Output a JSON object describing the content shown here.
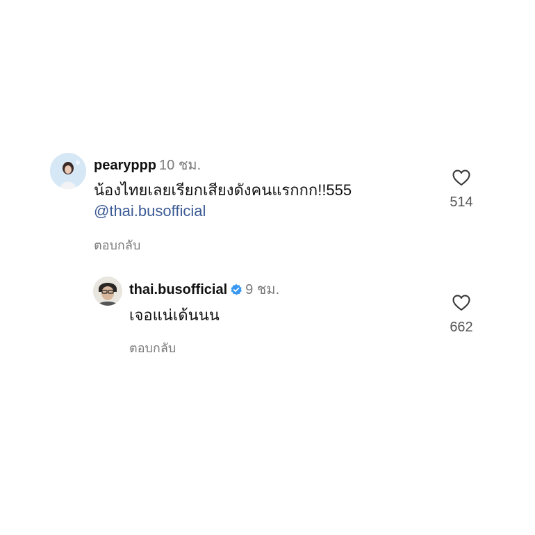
{
  "comments": [
    {
      "username": "pearyppp",
      "time": "10 ชม.",
      "text": "น้องไทยเลยเรียกเสียงดังคนแรกกก!!555",
      "mention": "@thai.busofficial",
      "reply_label": "ตอบกลับ",
      "likes": "514",
      "avatar_icon": "profile-photo"
    },
    {
      "username": "thai.busofficial",
      "verified": true,
      "time": "9 ชม.",
      "text": "เจอแน่เด้นนน",
      "reply_label": "ตอบกลับ",
      "likes": "662",
      "avatar_icon": "profile-photo"
    }
  ],
  "colors": {
    "mention": "#3b5a94",
    "secondary_text": "#7a7a7a",
    "verified_badge": "#3897f0"
  },
  "icons": {
    "like": "heart-outline-icon",
    "verified": "verified-badge-icon"
  }
}
